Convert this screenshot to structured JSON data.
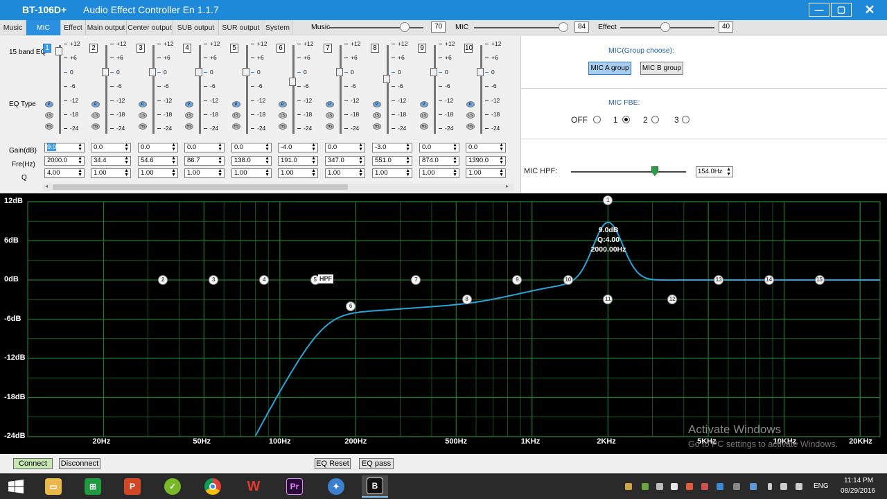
{
  "window": {
    "app_name": "BT-106D+",
    "title": "Audio Effect Controller En 1.1.7",
    "min_glyph": "—",
    "max_glyph": "▢",
    "close_glyph": "✕"
  },
  "tabs": [
    "Music",
    "MIC",
    "Effect",
    "Main output",
    "Center output",
    "SUB output",
    "SUR  output",
    "System"
  ],
  "active_tab": "MIC",
  "volumes": [
    {
      "label": "Music",
      "value": "70"
    },
    {
      "label": "MIC",
      "value": "84"
    },
    {
      "label": "Effect",
      "value": "40"
    }
  ],
  "eq": {
    "title": "15 band EQ",
    "eq_type_label": "EQ Type",
    "gain_label": "Gain(dB)",
    "freq_label": "Fre(Hz)",
    "q_label": "Q",
    "ticks": [
      "+12",
      "+6",
      "0",
      "-6",
      "-12",
      "-18",
      "-24"
    ],
    "type_buttons": [
      "P.",
      "LS",
      "HS"
    ],
    "bands": [
      {
        "num": "1",
        "gain": "9.0",
        "freq": "2000.0",
        "q": "4.00",
        "active": true
      },
      {
        "num": "2",
        "gain": "0.0",
        "freq": "34.4",
        "q": "1.00"
      },
      {
        "num": "3",
        "gain": "0.0",
        "freq": "54.6",
        "q": "1.00"
      },
      {
        "num": "4",
        "gain": "0.0",
        "freq": "86.7",
        "q": "1.00"
      },
      {
        "num": "5",
        "gain": "0.0",
        "freq": "138.0",
        "q": "1.00"
      },
      {
        "num": "6",
        "gain": "-4.0",
        "freq": "191.0",
        "q": "1.00"
      },
      {
        "num": "7",
        "gain": "0.0",
        "freq": "347.0",
        "q": "1.00"
      },
      {
        "num": "8",
        "gain": "-3.0",
        "freq": "551.0",
        "q": "1.00"
      },
      {
        "num": "9",
        "gain": "0.0",
        "freq": "874.0",
        "q": "1.00"
      },
      {
        "num": "10",
        "gain": "0.0",
        "freq": "1390.0",
        "q": "1.00"
      }
    ]
  },
  "mic_group": {
    "title": "MIC(Group choose):",
    "a_label": "MIC A group",
    "b_label": "MIC B group",
    "selected": "A"
  },
  "mic_fbe": {
    "title": "MIC FBE:",
    "options": [
      "OFF",
      "1",
      "2",
      "3"
    ],
    "selected": "1"
  },
  "mic_hpf": {
    "label": "MIC HPF:",
    "value": "154.0Hz"
  },
  "graph": {
    "db_labels": [
      "12dB",
      "6dB",
      "0dB",
      "-6dB",
      "-12dB",
      "-18dB",
      "-24dB"
    ],
    "freq_labels": [
      "20Hz",
      "50Hz",
      "100Hz",
      "200Hz",
      "500Hz",
      "1KHz",
      "2KHz",
      "5KHz",
      "10KHz",
      "20KHz"
    ],
    "hpf_tag": "HPF",
    "peak_gain": "9.0dB",
    "peak_q": "Q:4.00",
    "peak_freq": "2000.00Hz",
    "curve_color": "#29a6d8",
    "grid_color": "#1f7a2a",
    "nodes": [
      "1",
      "2",
      "3",
      "4",
      "5",
      "6",
      "7",
      "8",
      "9",
      "10",
      "11",
      "12",
      "13",
      "14",
      "15"
    ]
  },
  "watermark": {
    "line1": "Activate Windows",
    "line2": "Go to PC settings to activate Windows."
  },
  "bottom": {
    "connect": "Connect",
    "disconnect": "Disconnect",
    "eq_reset": "EQ Reset",
    "eq_pass": "EQ pass"
  },
  "taskbar": {
    "lang": "ENG",
    "time": "11:14 PM",
    "date": "08/29/2016"
  }
}
